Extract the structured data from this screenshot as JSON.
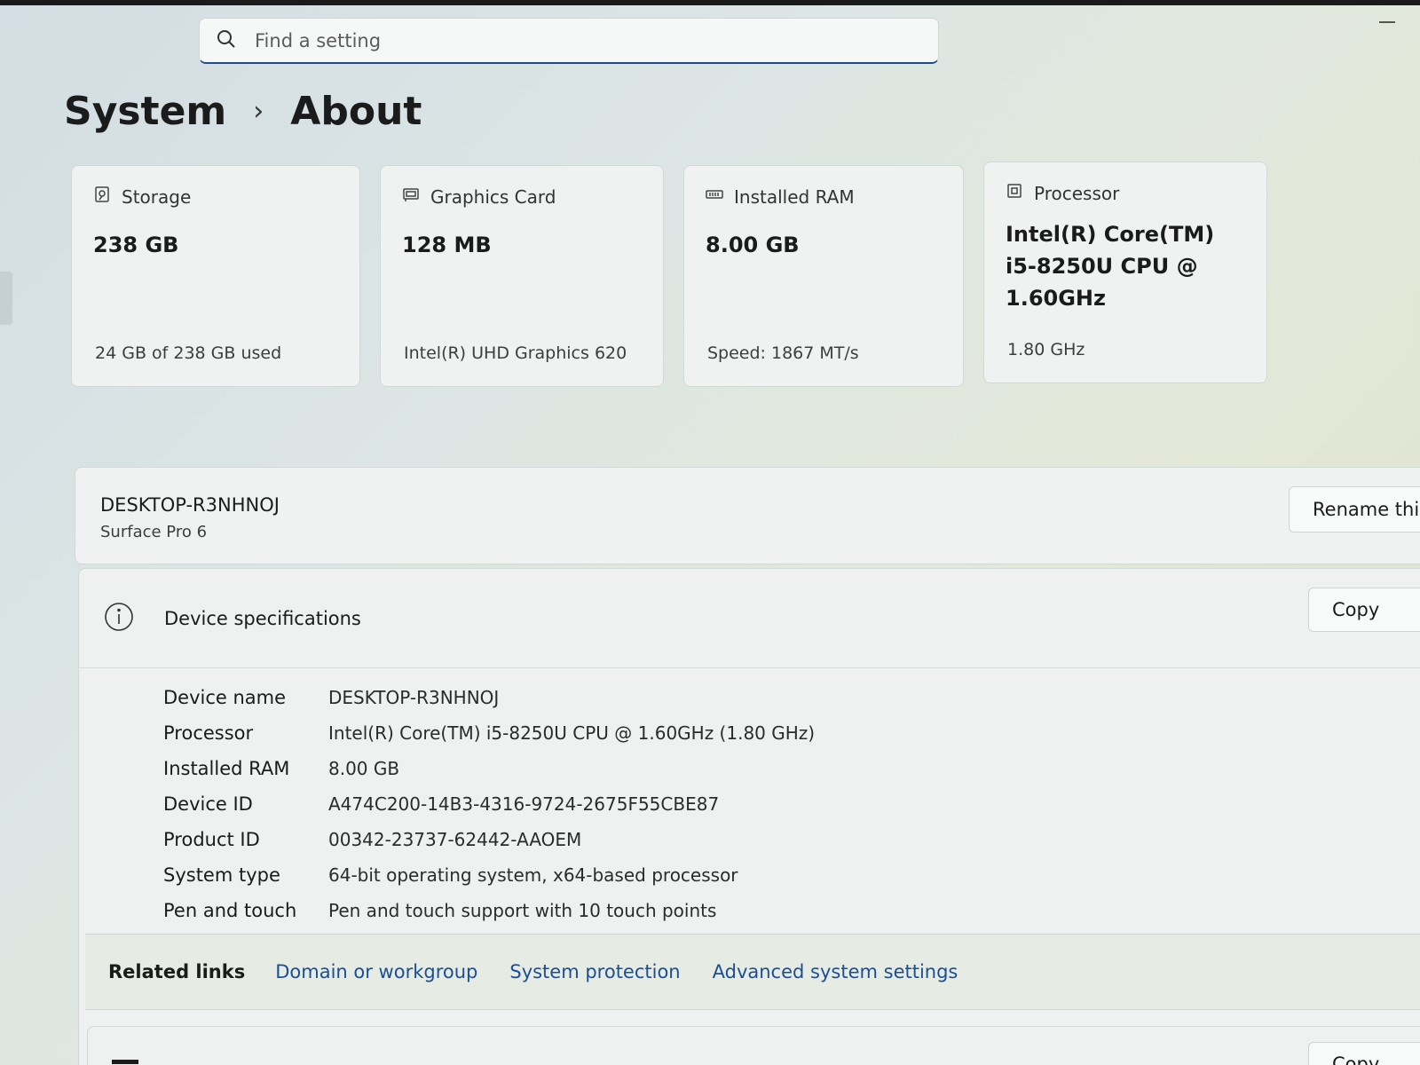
{
  "search": {
    "placeholder": "Find a setting"
  },
  "breadcrumb": {
    "parent": "System",
    "separator": "›",
    "current": "About"
  },
  "cards": [
    {
      "title": "Storage",
      "value": "238 GB",
      "sub": "24 GB of 238 GB used",
      "icon": "storage-icon"
    },
    {
      "title": "Graphics Card",
      "value": "128 MB",
      "sub": "Intel(R) UHD Graphics 620",
      "icon": "graphics-card-icon"
    },
    {
      "title": "Installed RAM",
      "value": "8.00 GB",
      "sub": "Speed: 1867 MT/s",
      "icon": "ram-icon"
    },
    {
      "title": "Processor",
      "value": "Intel(R) Core(TM) i5-8250U CPU @ 1.60GHz",
      "sub": "1.80 GHz",
      "icon": "processor-icon"
    }
  ],
  "device": {
    "name": "DESKTOP-R3NHNOJ",
    "model": "Surface Pro 6",
    "rename_label": "Rename this"
  },
  "specs": {
    "title": "Device specifications",
    "copy_label": "Copy",
    "rows": [
      {
        "label": "Device name",
        "value": "DESKTOP-R3NHNOJ"
      },
      {
        "label": "Processor",
        "value": "Intel(R) Core(TM) i5-8250U CPU @ 1.60GHz (1.80 GHz)"
      },
      {
        "label": "Installed RAM",
        "value": "8.00 GB"
      },
      {
        "label": "Device ID",
        "value": "A474C200-14B3-4316-9724-2675F55CBE87"
      },
      {
        "label": "Product ID",
        "value": "00342-23737-62442-AAOEM"
      },
      {
        "label": "System type",
        "value": "64-bit operating system, x64-based processor"
      },
      {
        "label": "Pen and touch",
        "value": "Pen and touch support with 10 touch points"
      }
    ]
  },
  "related": {
    "label": "Related links",
    "links": [
      "Domain or workgroup",
      "System protection",
      "Advanced system settings"
    ]
  },
  "next_panel": {
    "copy_label": "Copy"
  },
  "colors": {
    "accent": "#1f4c8f",
    "link": "#1a4f96"
  }
}
